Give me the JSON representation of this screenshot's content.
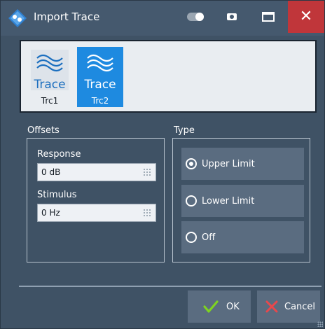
{
  "window": {
    "title": "Import Trace",
    "icons": {
      "app": "rs-logo-icon",
      "toggle": "toggle-icon",
      "camera": "camera-icon",
      "maximize": "maximize-icon",
      "close": "close-icon"
    },
    "colors": {
      "titlebar": "#45596e",
      "close": "#c0363a",
      "accent": "#1e8ae0"
    }
  },
  "traces": [
    {
      "icon_text": "Trace",
      "label": "Trc1",
      "selected": false
    },
    {
      "icon_text": "Trace",
      "label": "Trc2",
      "selected": true
    }
  ],
  "offsets": {
    "title": "Offsets",
    "response": {
      "label": "Response",
      "value": "0 dB"
    },
    "stimulus": {
      "label": "Stimulus",
      "value": "0 Hz"
    }
  },
  "type": {
    "title": "Type",
    "options": [
      {
        "label": "Upper Limit",
        "selected": true
      },
      {
        "label": "Lower Limit",
        "selected": false
      },
      {
        "label": "Off",
        "selected": false
      }
    ]
  },
  "footer": {
    "ok_label": "OK",
    "cancel_label": "Cancel"
  }
}
